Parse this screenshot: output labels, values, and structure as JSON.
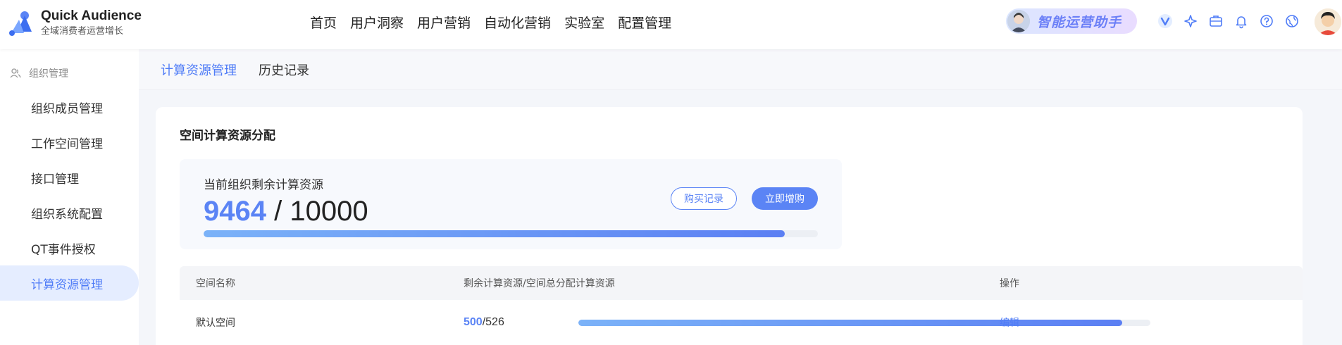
{
  "app": {
    "title": "Quick Audience",
    "subtitle": "全域消费者运营增长"
  },
  "nav": [
    {
      "label": "首页"
    },
    {
      "label": "用户洞察"
    },
    {
      "label": "用户营销"
    },
    {
      "label": "自动化营销"
    },
    {
      "label": "实验室"
    },
    {
      "label": "配置管理"
    }
  ],
  "assistant": {
    "label": "智能运营助手"
  },
  "tools": [
    "v-logo-icon",
    "sparkle-icon",
    "briefcase-icon",
    "bell-icon",
    "help-icon",
    "globe-icon"
  ],
  "sidebar": {
    "group": "组织管理",
    "items": [
      {
        "label": "组织成员管理",
        "active": false
      },
      {
        "label": "工作空间管理",
        "active": false
      },
      {
        "label": "接口管理",
        "active": false
      },
      {
        "label": "组织系统配置",
        "active": false
      },
      {
        "label": "QT事件授权",
        "active": false
      },
      {
        "label": "计算资源管理",
        "active": true
      }
    ]
  },
  "tabs": [
    {
      "label": "计算资源管理",
      "active": true
    },
    {
      "label": "历史记录",
      "active": false
    }
  ],
  "card": {
    "title": "空间计算资源分配",
    "quota": {
      "label": "当前组织剩余计算资源",
      "remaining": "9464",
      "separator": " / ",
      "total": "10000",
      "remaining_value": 9464,
      "total_value": 10000
    },
    "buttons": {
      "history": "购买记录",
      "buy": "立即增购"
    },
    "table": {
      "columns": [
        "空间名称",
        "剩余计算资源/空间总分配计算资源",
        "操作"
      ],
      "rows": [
        {
          "name": "默认空间",
          "remaining": "500",
          "total": "/526",
          "remaining_value": 500,
          "total_value": 526,
          "action": "编辑"
        }
      ]
    }
  },
  "colors": {
    "accent": "#5b84f5",
    "active_bg": "#e5edff"
  }
}
